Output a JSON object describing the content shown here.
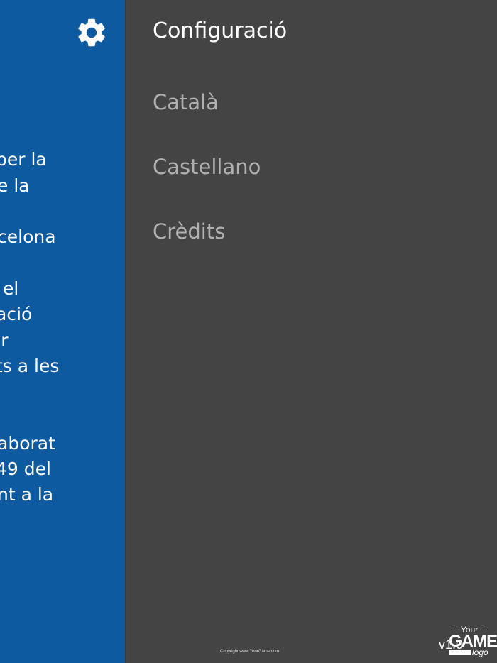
{
  "left_panel": {
    "background": "#0e5aa1",
    "gear_icon": "gear-icon",
    "lines": [
      "per la",
      "e la",
      "celona",
      "el",
      "ació",
      "or",
      "ts a les",
      "aborat",
      "49 del",
      "nt a la"
    ]
  },
  "menu": {
    "background": "#444444",
    "title": "Configuració",
    "items": [
      "Català",
      "Castellano",
      "Crèdits"
    ]
  },
  "footer": {
    "copyright": "Copyright www.YourGame.com",
    "version": "v1.0",
    "logo_your": "Your",
    "logo_game": "GAME",
    "logo_small": "logo"
  }
}
